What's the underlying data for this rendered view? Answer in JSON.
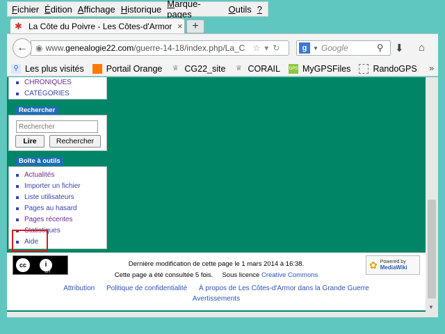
{
  "menubar": {
    "items": [
      {
        "u": "F",
        "rest": "ichier"
      },
      {
        "u": "É",
        "rest": "dition"
      },
      {
        "u": "A",
        "rest": "ffichage"
      },
      {
        "u": "H",
        "rest": "istorique"
      },
      {
        "u": "M",
        "rest": "arque-pages"
      },
      {
        "u": "O",
        "rest": "utils"
      },
      {
        "u": "?",
        "rest": ""
      }
    ]
  },
  "tab": {
    "title": "La Côte du Poivre - Les Côtes-d'Armor d...",
    "close": "×",
    "new_tab": "+"
  },
  "navbar": {
    "url_prefix": "www.",
    "url_domain": "genealogie22.com",
    "url_path": "/guerre-14-18/index.php/La_C",
    "search_placeholder": "Google",
    "search_engine_letter": "g"
  },
  "bookmarks": [
    {
      "label": "Les plus visités",
      "icon": "search-icon",
      "color": "#2b6fd0"
    },
    {
      "label": "Portail Orange",
      "icon": "orange-icon",
      "color": "#ff7900"
    },
    {
      "label": "CG22_site",
      "icon": "crest-icon",
      "color": "#3c6b2f"
    },
    {
      "label": "CORAIL",
      "icon": "crest-icon",
      "color": "#3c6b2f"
    },
    {
      "label": "MyGPSFiles",
      "icon": "gps-icon",
      "color": "#8ec63f"
    },
    {
      "label": "RandoGPS",
      "icon": "page-icon",
      "color": "#ffffff"
    }
  ],
  "sidebar": {
    "top_links": [
      "CHRONIQUES",
      "CATÉGORIES"
    ],
    "search_title": "Rechercher",
    "search_placeholder": "Rechercher",
    "go_button": "Lire",
    "search_button": "Rechercher",
    "toolbox_title": "Boîte à outils",
    "toolbox_links": [
      "Actualités",
      "Importer un fichier",
      "Liste utilisateurs",
      "Pages au hasard",
      "Pages récentes",
      "Statistiques",
      "Aide"
    ]
  },
  "footer": {
    "last_modified": "Dernière modification de cette page le 1 mars 2014 à 16:38.",
    "views": "Cette page a été consultée 5 fois.",
    "licence_prefix": "Sous licence",
    "licence_link": "Creative Commons",
    "links": [
      "Attribution",
      "Politique de confidentialité",
      "À propos de Les Côtes-d'Armor dans la Grande Guerre",
      "Avertissements"
    ],
    "cc_badge": {
      "cc": "cc",
      "by": "BY"
    },
    "mediawiki_badge": {
      "line1": "Powered by",
      "line2": "MediaWiki"
    }
  },
  "colors": {
    "page_green": "#008566",
    "link_blue": "#3a42aa",
    "highlight_red": "#e01515",
    "portlet_title_blue": "#1f6db5"
  }
}
